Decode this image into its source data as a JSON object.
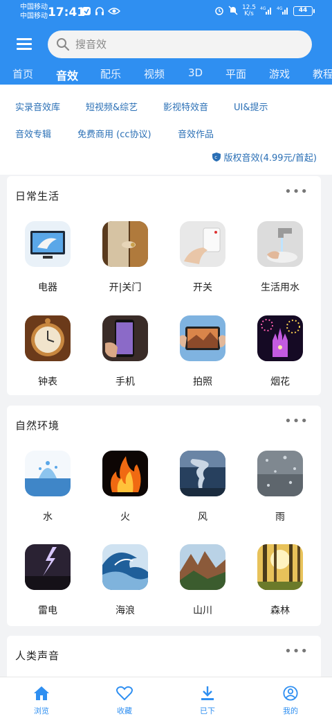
{
  "status_bar": {
    "carrier1": "中国移动",
    "carrier2": "中国移动",
    "time": "17:41",
    "net_speed": "12.5",
    "net_unit": "K/s",
    "battery": "44"
  },
  "search": {
    "placeholder": "搜音效"
  },
  "tabs": [
    "首页",
    "音效",
    "配乐",
    "视频",
    "3D",
    "平面",
    "游戏",
    "教程"
  ],
  "active_tab": "音效",
  "links": {
    "row1": [
      "实录音效库",
      "短视频&综艺",
      "影视特效音",
      "UI&提示"
    ],
    "row2": [
      "音效专辑",
      "免费商用 (cc协议)",
      "音效作品"
    ],
    "copyright": "版权音效(4.99元/首起)"
  },
  "sections": [
    {
      "title": "日常生活",
      "more": "•••",
      "items": [
        "电器",
        "开|关门",
        "开关",
        "生活用水",
        "钟表",
        "手机",
        "拍照",
        "烟花"
      ]
    },
    {
      "title": "自然环境",
      "more": "•••",
      "items": [
        "水",
        "火",
        "风",
        "雨",
        "雷电",
        "海浪",
        "山川",
        "森林"
      ]
    },
    {
      "title": "人类声音",
      "more": "•••",
      "items": []
    }
  ],
  "bottom_nav": [
    "浏览",
    "收藏",
    "已下",
    "我的"
  ],
  "colors": {
    "brand": "#2f8ff1",
    "link": "#2a6fb5"
  }
}
